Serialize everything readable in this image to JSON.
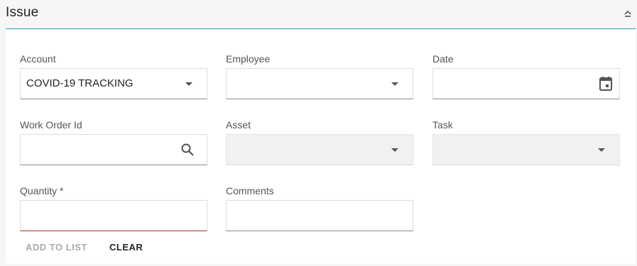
{
  "section": {
    "title": "Issue"
  },
  "form": {
    "account": {
      "label": "Account",
      "value": "COVID-19 TRACKING"
    },
    "employee": {
      "label": "Employee",
      "value": ""
    },
    "date": {
      "label": "Date",
      "value": ""
    },
    "work_order_id": {
      "label": "Work Order Id",
      "value": ""
    },
    "asset": {
      "label": "Asset",
      "value": ""
    },
    "task": {
      "label": "Task",
      "value": ""
    },
    "quantity": {
      "label": "Quantity *",
      "value": ""
    },
    "comments": {
      "label": "Comments",
      "value": ""
    }
  },
  "actions": {
    "add_to_list": "ADD TO LIST",
    "clear": "CLEAR"
  },
  "colors": {
    "accent_rule": "#2ba3b8",
    "error_underline": "#a43232"
  },
  "icons": {
    "collapse": "chevron-up-icon",
    "dropdown": "caret-down-icon",
    "calendar": "calendar-icon",
    "search": "search-icon"
  }
}
